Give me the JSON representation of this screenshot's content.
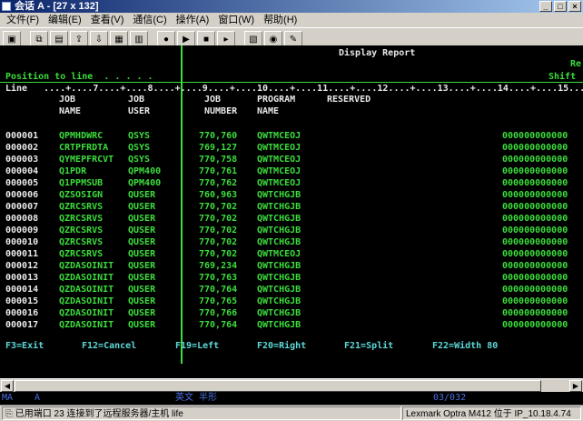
{
  "window": {
    "title": "会话 A - [27 x 132]"
  },
  "menu": [
    "文件(F)",
    "编辑(E)",
    "查看(V)",
    "通信(C)",
    "操作(A)",
    "窗口(W)",
    "帮助(H)"
  ],
  "toolbar_icons": [
    "print-screen-icon",
    "copy-icon",
    "paste-icon",
    "send-file-icon",
    "receive-file-icon",
    "display-setup-icon",
    "keyboard-map-icon",
    "record-macro-icon",
    "play-macro-icon",
    "stop-macro-icon",
    "macro-run-icon",
    "clipboard-icon",
    "web-icon",
    "help-icon"
  ],
  "screen": {
    "header_title": "Display Report",
    "header_right": "Re",
    "position_label": "Position to line  . . . . .",
    "shift_label": "Shift",
    "ruler": "Line   ....+....7....+....8....+....9....+....10....+....11....+....12....+....13....+....14....+....15....",
    "col_headers": {
      "job_name_1": "JOB",
      "job_name_2": "NAME",
      "job_user_1": "JOB",
      "job_user_2": "USER",
      "job_number_1": "JOB",
      "job_number_2": "NUMBER",
      "program_1": "PROGRAM",
      "program_2": "NAME",
      "reserved": "RESERVED"
    },
    "rows": [
      {
        "line": "000001",
        "name": "QPMHDWRC",
        "user": "QSYS",
        "number": "770,760",
        "program": "QWTMCEOJ",
        "data": "000000000000"
      },
      {
        "line": "000002",
        "name": "CRTPFRDTA",
        "user": "QSYS",
        "number": "769,127",
        "program": "QWTMCEOJ",
        "data": "000000000000"
      },
      {
        "line": "000003",
        "name": "QYMEPFRCVT",
        "user": "QSYS",
        "number": "770,758",
        "program": "QWTMCEOJ",
        "data": "000000000000"
      },
      {
        "line": "000004",
        "name": "Q1PDR",
        "user": "QPM400",
        "number": "770,761",
        "program": "QWTMCEOJ",
        "data": "000000000000"
      },
      {
        "line": "000005",
        "name": "Q1PPMSUB",
        "user": "QPM400",
        "number": "770,762",
        "program": "QWTMCEOJ",
        "data": "000000000000"
      },
      {
        "line": "000006",
        "name": "QZSOSIGN",
        "user": "QUSER",
        "number": "760,963",
        "program": "QWTCHGJB",
        "data": "000000000000"
      },
      {
        "line": "000007",
        "name": "QZRCSRVS",
        "user": "QUSER",
        "number": "770,702",
        "program": "QWTCHGJB",
        "data": "000000000000"
      },
      {
        "line": "000008",
        "name": "QZRCSRVS",
        "user": "QUSER",
        "number": "770,702",
        "program": "QWTCHGJB",
        "data": "000000000000"
      },
      {
        "line": "000009",
        "name": "QZRCSRVS",
        "user": "QUSER",
        "number": "770,702",
        "program": "QWTCHGJB",
        "data": "000000000000"
      },
      {
        "line": "000010",
        "name": "QZRCSRVS",
        "user": "QUSER",
        "number": "770,702",
        "program": "QWTCHGJB",
        "data": "000000000000"
      },
      {
        "line": "000011",
        "name": "QZRCSRVS",
        "user": "QUSER",
        "number": "770,702",
        "program": "QWTMCEOJ",
        "data": "000000000000"
      },
      {
        "line": "000012",
        "name": "QZDASOINIT",
        "user": "QUSER",
        "number": "769,234",
        "program": "QWTCHGJB",
        "data": "000000000000"
      },
      {
        "line": "000013",
        "name": "QZDASOINIT",
        "user": "QUSER",
        "number": "770,763",
        "program": "QWTCHGJB",
        "data": "000000000000"
      },
      {
        "line": "000014",
        "name": "QZDASOINIT",
        "user": "QUSER",
        "number": "770,764",
        "program": "QWTCHGJB",
        "data": "000000000000"
      },
      {
        "line": "000015",
        "name": "QZDASOINIT",
        "user": "QUSER",
        "number": "770,765",
        "program": "QWTCHGJB",
        "data": "000000000000"
      },
      {
        "line": "000016",
        "name": "QZDASOINIT",
        "user": "QUSER",
        "number": "770,766",
        "program": "QWTCHGJB",
        "data": "000000000000"
      },
      {
        "line": "000017",
        "name": "QZDASOINIT",
        "user": "QUSER",
        "number": "770,764",
        "program": "QWTCHGJB",
        "data": "000000000000"
      }
    ],
    "fkeys": [
      "F3=Exit",
      "F12=Cancel",
      "F19=Left",
      "F20=Right",
      "F21=Split",
      "F22=Width 80"
    ]
  },
  "oia": {
    "ma": "MA",
    "mode": "A",
    "input": "英文 半形",
    "cursor": "03/032"
  },
  "status": {
    "message": "已用端口 23 连接到了远程服务器/主机 life",
    "printer": "Lexmark Optra M412 位于 IP_10.18.4.74"
  }
}
